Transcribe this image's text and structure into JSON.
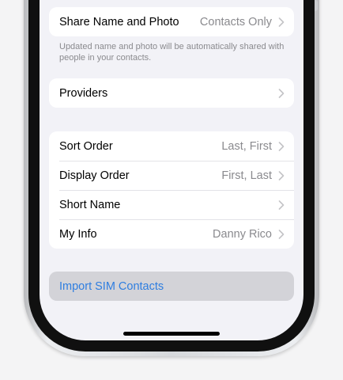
{
  "settings": {
    "share_section": {
      "label": "Share Name and Photo",
      "value": "Contacts Only",
      "footnote": "Updated name and photo will be automatically shared with people in your contacts."
    },
    "providers": {
      "label": "Providers"
    },
    "display_section": {
      "rows": [
        {
          "label": "Sort Order",
          "value": "Last, First"
        },
        {
          "label": "Display Order",
          "value": "First, Last"
        },
        {
          "label": "Short Name",
          "value": ""
        },
        {
          "label": "My Info",
          "value": "Danny Rico"
        }
      ]
    },
    "import_sim": {
      "label": "Import SIM Contacts"
    }
  },
  "icons": {
    "chevron": "chevron-right-icon"
  },
  "colors": {
    "accent": "#2f7ee0",
    "background": "#f2f2f7",
    "secondary_text": "#8a8a8e",
    "highlight": "#d3d3d8"
  }
}
